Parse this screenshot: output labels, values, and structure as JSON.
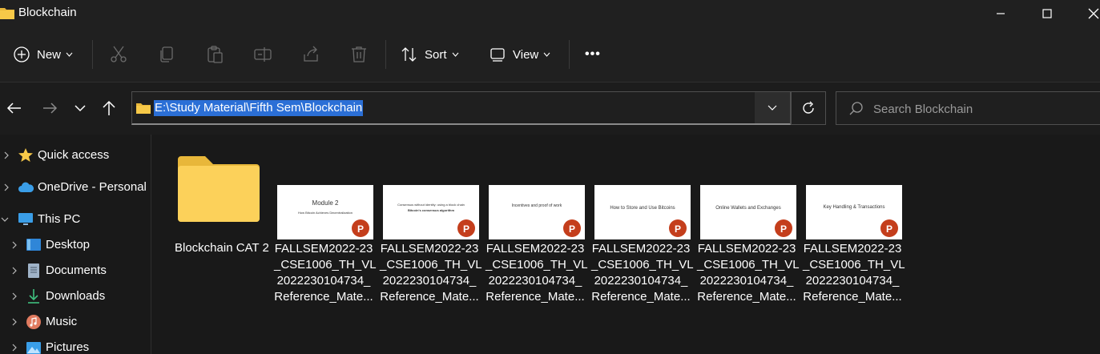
{
  "window": {
    "title": "Blockchain"
  },
  "toolbar": {
    "new_label": "New",
    "sort_label": "Sort",
    "view_label": "View",
    "more_label": "•••"
  },
  "navigation": {
    "address": "E:\\Study Material\\Fifth Sem\\Blockchain",
    "search_placeholder": "Search Blockchain"
  },
  "sidebar": {
    "items": [
      {
        "label": "Quick access",
        "icon": "star-icon"
      },
      {
        "label": "OneDrive - Personal",
        "icon": "cloud-icon"
      },
      {
        "label": "This PC",
        "icon": "monitor-icon"
      },
      {
        "label": "Desktop",
        "icon": "desktop-icon"
      },
      {
        "label": "Documents",
        "icon": "document-icon"
      },
      {
        "label": "Downloads",
        "icon": "download-icon"
      },
      {
        "label": "Music",
        "icon": "music-icon"
      },
      {
        "label": "Pictures",
        "icon": "picture-icon"
      }
    ]
  },
  "files": {
    "folder": {
      "name": "Blockchain CAT 2"
    },
    "items": [
      {
        "line1": "FALLSEM2022-23",
        "line2": "_CSE1006_TH_VL",
        "line3": "2022230104734_",
        "line4": "Reference_Mate...",
        "slide_title": "Module 2",
        "slide_sub": "How Bitcoin Achieves Decentralization"
      },
      {
        "line1": "FALLSEM2022-23",
        "line2": "_CSE1006_TH_VL",
        "line3": "2022230104734_",
        "line4": "Reference_Mate...",
        "slide_title": "Consensus without identity: using a block chain",
        "slide_sub": "Bitcoin's consensus algorithm"
      },
      {
        "line1": "FALLSEM2022-23",
        "line2": "_CSE1006_TH_VL",
        "line3": "2022230104734_",
        "line4": "Reference_Mate...",
        "slide_title": "Incentives and proof of work",
        "slide_sub": ""
      },
      {
        "line1": "FALLSEM2022-23",
        "line2": "_CSE1006_TH_VL",
        "line3": "2022230104734_",
        "line4": "Reference_Mate...",
        "slide_title": "How to Store and Use Bitcoins",
        "slide_sub": ""
      },
      {
        "line1": "FALLSEM2022-23",
        "line2": "_CSE1006_TH_VL",
        "line3": "2022230104734_",
        "line4": "Reference_Mate...",
        "slide_title": "Online Wallets and Exchanges",
        "slide_sub": ""
      },
      {
        "line1": "FALLSEM2022-23",
        "line2": "_CSE1006_TH_VL",
        "line3": "2022230104734_",
        "line4": "Reference_Mate...",
        "slide_title": "Key Handling & Transactions",
        "slide_sub": ""
      }
    ]
  },
  "colors": {
    "accent": "#2b6fd6",
    "folder": "#f7c948",
    "powerpoint": "#c43e1c"
  }
}
